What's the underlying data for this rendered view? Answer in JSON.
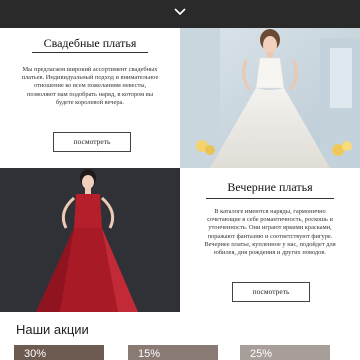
{
  "nav": {
    "chevron_icon": "chevron-down-icon"
  },
  "wedding": {
    "title": "Свадебные платья",
    "description": "Мы предлагаем широкий ассортимент свадебных платьев. Индивидуальный подход и внимательное отношение ко всем пожеланиям невесты, позволяют нам подобрать наряд, в котором вы будете королевой вечера.",
    "button_label": "посмотреть"
  },
  "evening": {
    "title": "Вечерние платья",
    "description": "В каталоге имеются наряды, гармонично сочетающие в себе романтичность, роскошь и утонченность. Они играют яркими красками, поражают фантазию и соответствуют фигуре. Вечернее платье, купленное у нас, подойдет для юбилея, дня рождения и других поводов.",
    "button_label": "посмотреть"
  },
  "promotions": {
    "heading": "Наши акции",
    "cards": [
      {
        "badge": "30%"
      },
      {
        "badge": "15%"
      },
      {
        "badge": "25%"
      }
    ]
  }
}
